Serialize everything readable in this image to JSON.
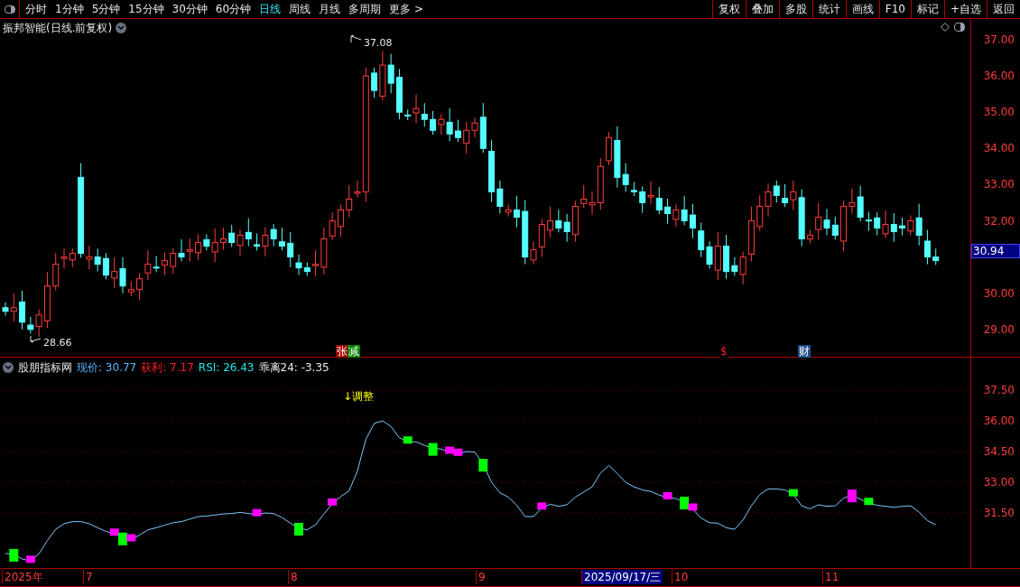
{
  "toolbar": {
    "periods": [
      {
        "label": "分时",
        "selected": false
      },
      {
        "label": "1分钟",
        "selected": false
      },
      {
        "label": "5分钟",
        "selected": false
      },
      {
        "label": "15分钟",
        "selected": false
      },
      {
        "label": "30分钟",
        "selected": false
      },
      {
        "label": "60分钟",
        "selected": false
      },
      {
        "label": "日线",
        "selected": true
      },
      {
        "label": "周线",
        "selected": false
      },
      {
        "label": "月线",
        "selected": false
      },
      {
        "label": "多周期",
        "selected": false
      },
      {
        "label": "更多 >",
        "selected": false
      }
    ],
    "actions": [
      "复权",
      "叠加",
      "多股",
      "统计",
      "画线",
      "F10",
      "标记",
      "+自选",
      "返回"
    ]
  },
  "price_chart": {
    "title": "振邦智能(日线.前复权)",
    "high_marker": "37.08",
    "low_marker": "28.66",
    "events": [
      {
        "label": "张",
        "color": "#a00000"
      },
      {
        "label": "减",
        "color": "#008000"
      },
      {
        "label": "$",
        "color": "#000000"
      },
      {
        "label": "财",
        "color": "#1e4f8c"
      }
    ],
    "axis_labels": [
      "37.00",
      "36.00",
      "35.00",
      "34.00",
      "33.00",
      "32.00",
      "30.00",
      "29.00"
    ],
    "price_tag": "30.94"
  },
  "indicator": {
    "name": "股朋指标网",
    "values": [
      {
        "label": "现价: 30.77",
        "color": "#5ab4ff"
      },
      {
        "label": "获利: 7.17",
        "color": "#ff2020"
      },
      {
        "label": "RSI: 26.43",
        "color": "#20e8e8"
      },
      {
        "label": "乖离24: -3.35",
        "color": "#e8e8e8"
      }
    ],
    "signal": "↓调整",
    "axis_labels": [
      "37.50",
      "36.00",
      "34.50",
      "33.00",
      "31.50"
    ]
  },
  "time_axis": [
    {
      "label": "2025年",
      "selected": false
    },
    {
      "label": "7",
      "selected": false
    },
    {
      "label": "8",
      "selected": false
    },
    {
      "label": "9",
      "selected": false
    },
    {
      "label": "2025/09/17/三",
      "selected": true
    },
    {
      "label": "10",
      "selected": false
    },
    {
      "label": "11",
      "selected": false
    }
  ]
}
